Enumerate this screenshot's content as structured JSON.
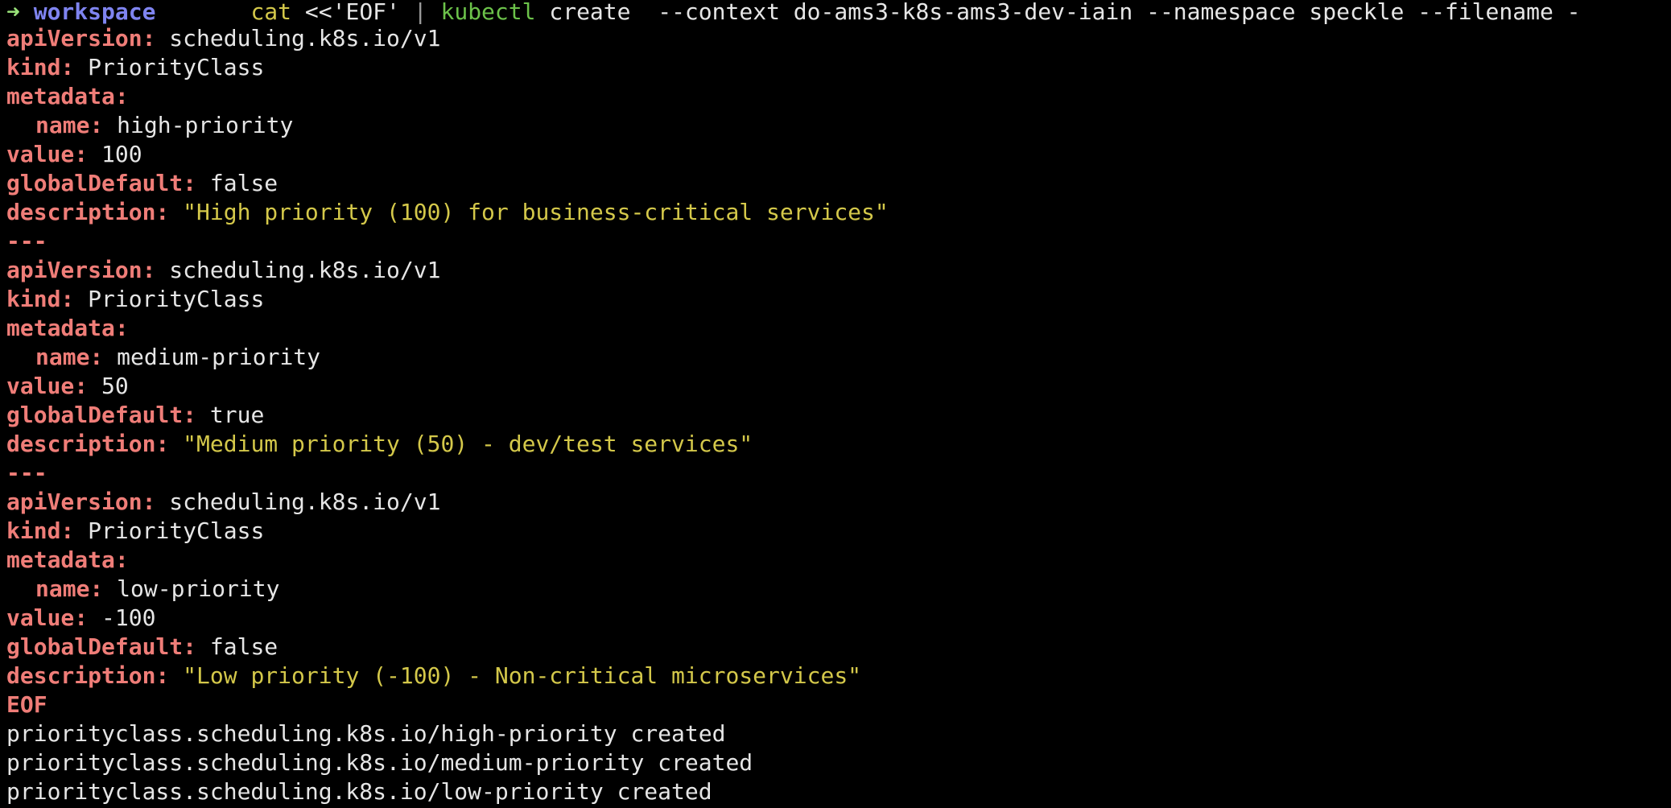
{
  "prompt": {
    "arrow": "➜",
    "directory": "workspace",
    "cmd_cat": "cat",
    "cmd_heredoc": "<<'EOF'",
    "cmd_pipe": "|",
    "cmd_kubectl": "kubectl",
    "cmd_args": "create  --context do-ams3-k8s-ams3-dev-iain --namespace speckle --filename -"
  },
  "documents": [
    {
      "apiVersion_key": "apiVersion:",
      "apiVersion": "scheduling.k8s.io/v1",
      "kind_key": "kind:",
      "kind": "PriorityClass",
      "metadata_key": "metadata:",
      "name_key": "name:",
      "name": "high-priority",
      "value_key": "value:",
      "value": "100",
      "globalDefault_key": "globalDefault:",
      "globalDefault": "false",
      "description_key": "description:",
      "description": "\"High priority (100) for business-critical services\""
    },
    {
      "apiVersion_key": "apiVersion:",
      "apiVersion": "scheduling.k8s.io/v1",
      "kind_key": "kind:",
      "kind": "PriorityClass",
      "metadata_key": "metadata:",
      "name_key": "name:",
      "name": "medium-priority",
      "value_key": "value:",
      "value": "50",
      "globalDefault_key": "globalDefault:",
      "globalDefault": "true",
      "description_key": "description:",
      "description": "\"Medium priority (50) - dev/test services\""
    },
    {
      "apiVersion_key": "apiVersion:",
      "apiVersion": "scheduling.k8s.io/v1",
      "kind_key": "kind:",
      "kind": "PriorityClass",
      "metadata_key": "metadata:",
      "name_key": "name:",
      "name": "low-priority",
      "value_key": "value:",
      "value": "-100",
      "globalDefault_key": "globalDefault:",
      "globalDefault": "false",
      "description_key": "description:",
      "description": "\"Low priority (-100) - Non-critical microservices\""
    }
  ],
  "separator": "---",
  "eof": "EOF",
  "output": [
    "priorityclass.scheduling.k8s.io/high-priority created",
    "priorityclass.scheduling.k8s.io/medium-priority created",
    "priorityclass.scheduling.k8s.io/low-priority created"
  ],
  "colors": {
    "background": "#000000",
    "key": "#ef7d78",
    "string": "#d4c84a",
    "text": "#e6e6e6",
    "prompt_arrow": "#9ae37a",
    "prompt_dir": "#7f84f0",
    "kubectl": "#6cc24a"
  }
}
